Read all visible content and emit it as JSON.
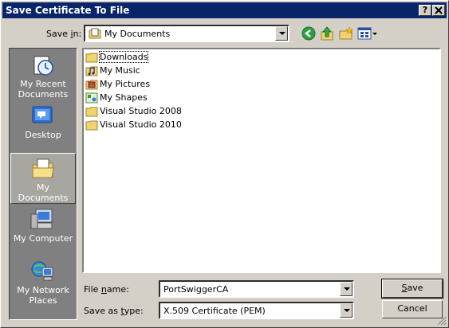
{
  "window": {
    "title": "Save Certificate To File",
    "help_label": "?",
    "close_label": "✕"
  },
  "toolbar": {
    "save_in_label_pre": "Save ",
    "save_in_label_key": "i",
    "save_in_label_post": "n:",
    "location": "My Documents",
    "icons": [
      "back-icon",
      "up-folder-icon",
      "new-folder-icon",
      "views-menu-icon"
    ]
  },
  "places": [
    {
      "label": "My Recent Documents",
      "icon": "recent-documents-icon"
    },
    {
      "label": "Desktop",
      "icon": "desktop-icon"
    },
    {
      "label": "My Documents",
      "icon": "my-documents-icon",
      "selected": true
    },
    {
      "label": "My Computer",
      "icon": "my-computer-icon"
    },
    {
      "label": "My Network Places",
      "icon": "network-places-icon"
    }
  ],
  "files": [
    {
      "name": "Downloads",
      "icon": "folder-icon"
    },
    {
      "name": "My Music",
      "icon": "music-folder-icon"
    },
    {
      "name": "My Pictures",
      "icon": "pictures-folder-icon"
    },
    {
      "name": "My Shapes",
      "icon": "shapes-folder-icon"
    },
    {
      "name": "Visual Studio 2008",
      "icon": "folder-icon"
    },
    {
      "name": "Visual Studio 2010",
      "icon": "folder-icon"
    }
  ],
  "form": {
    "file_name_label_pre": "File ",
    "file_name_label_key": "n",
    "file_name_label_post": "ame:",
    "file_name_value": "PortSwiggerCA",
    "save_type_label_pre": "Save as ",
    "save_type_label_key": "t",
    "save_type_label_post": "ype:",
    "save_type_value": "X.509 Certificate (PEM)"
  },
  "buttons": {
    "save_pre": "",
    "save_key": "S",
    "save_post": "ave",
    "cancel": "Cancel"
  },
  "colors": {
    "titlebar": "#0a246a",
    "face": "#d4d0c8",
    "places_bg": "#808080",
    "folder": "#f0d470"
  }
}
